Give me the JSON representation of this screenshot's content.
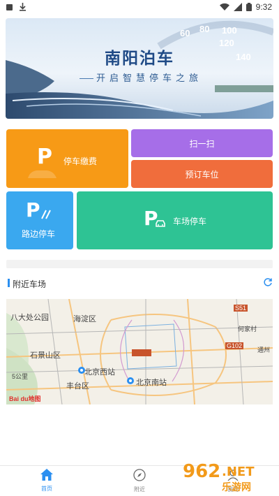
{
  "status_bar": {
    "time": "9:32"
  },
  "banner": {
    "title": "南阳泊车",
    "subtitle": "开启智慧停车之旅",
    "speedo_numbers": [
      "60",
      "80",
      "100",
      "120",
      "140"
    ]
  },
  "tiles": {
    "pay": {
      "label": "停车缴费"
    },
    "scan": {
      "label": "扫一扫"
    },
    "book": {
      "label": "预订车位"
    },
    "roadside": {
      "label": "路边停车"
    },
    "lot": {
      "label": "车场停车"
    }
  },
  "nearby": {
    "title": "附近车场"
  },
  "map": {
    "labels": {
      "badachu": "八大处公园",
      "haidian": "海淀区",
      "shijingshan": "石景山区",
      "beijing_west": "北京西站",
      "fengtai": "丰台区",
      "beijing_south": "北京南站",
      "hejiacun": "何家村",
      "tongzhou": "通州",
      "scale": "5公里",
      "road_g102": "G102",
      "road_s51": "S51",
      "logo": "Bai du地图"
    }
  },
  "bottom_nav": {
    "items": [
      {
        "label": "首页",
        "icon": "home-icon",
        "active": true
      },
      {
        "label": "附近",
        "icon": "compass-icon",
        "active": false
      },
      {
        "label": "我的",
        "icon": "user-icon",
        "active": false
      }
    ]
  },
  "watermark": {
    "number": "962",
    "net": ".NET",
    "site": "乐游网"
  },
  "colors": {
    "pay": "#f79a16",
    "scan": "#a66ee8",
    "book": "#f06d3c",
    "roadside": "#3aa8ef",
    "lot": "#2ec394",
    "accent": "#2b8ff0"
  }
}
